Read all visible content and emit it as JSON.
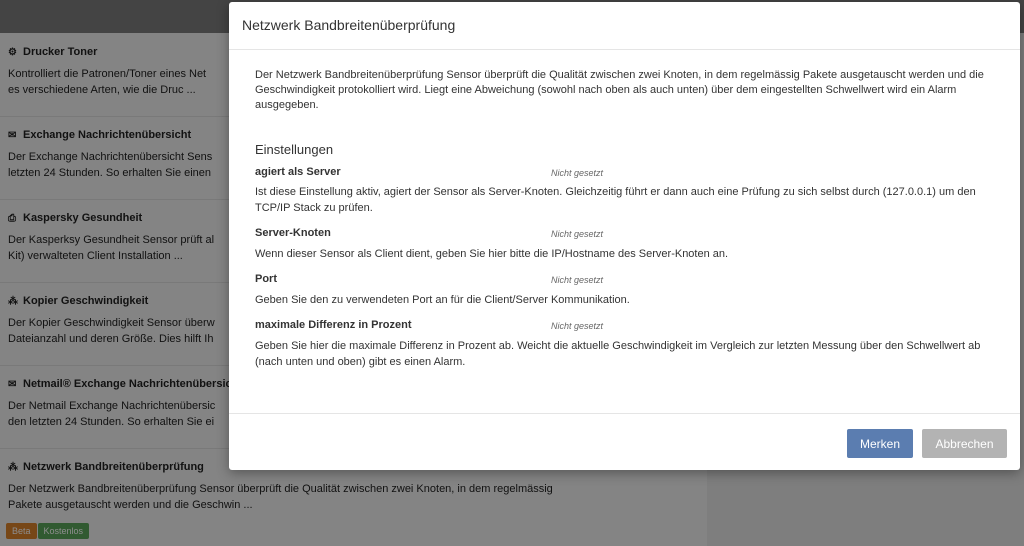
{
  "background": {
    "items": [
      {
        "icon": "gears-icon",
        "glyph": "⚙",
        "title": "Drucker Toner",
        "desc": "Kontrolliert die Patronen/Toner eines Net\nes verschiedene Arten, wie die Druc ..."
      },
      {
        "icon": "envelope-icon",
        "glyph": "✉",
        "title": "Exchange Nachrichtenübersicht",
        "desc": "Der Exchange Nachrichtenübersicht Sens\nletzten 24 Stunden. So erhalten Sie einen"
      },
      {
        "icon": "printer-icon",
        "glyph": "⎙",
        "title": "Kaspersky Gesundheit",
        "desc": "Der Kasperksy Gesundheit Sensor prüft al\nKit) verwalteten Client Installation ..."
      },
      {
        "icon": "sitemap-icon",
        "glyph": "⁂",
        "title": "Kopier Geschwindigkeit",
        "desc": "Der Kopier Geschwindigkeit Sensor überw\nDateianzahl und deren Größe. Dies hilft Ih"
      },
      {
        "icon": "envelope-icon",
        "glyph": "✉",
        "title": "Netmail® Exchange Nachrichtenübersicl",
        "desc": "Der Netmail Exchange Nachrichtenübersic\nden letzten 24 Stunden. So erhalten Sie ei"
      },
      {
        "icon": "sitemap-icon",
        "glyph": "⁂",
        "title": "Netzwerk Bandbreitenüberprüfung",
        "desc": "Der Netzwerk Bandbreitenüberprüfung Sensor überprüft die Qualität zwischen zwei Knoten, in dem regelmässig\nPakete ausgetauscht werden und die Geschwin ..."
      }
    ],
    "badges": [
      {
        "label": "Beta",
        "color": "#d9822b"
      },
      {
        "label": "Kostenlos",
        "color": "#5aa55a"
      }
    ]
  },
  "modal": {
    "title": "Netzwerk Bandbreitenüberprüfung",
    "intro": "Der Netzwerk Bandbreitenüberprüfung Sensor überprüft die Qualität zwischen zwei Knoten, in dem regelmässig Pakete ausgetauscht werden und die Geschwindigkeit protokolliert wird. Liegt eine Abweichung (sowohl nach oben als auch unten) über dem eingestellten Schwellwert wird ein Alarm ausgegeben.",
    "section_heading": "Einstellungen",
    "settings": [
      {
        "name": "agiert als Server",
        "status": "Nicht gesetzt",
        "desc": "Ist diese Einstellung aktiv, agiert der Sensor als Server-Knoten. Gleichzeitig führt er dann auch eine Prüfung zu sich selbst durch (127.0.0.1) um den TCP/IP Stack zu prüfen."
      },
      {
        "name": "Server-Knoten",
        "status": "Nicht gesetzt",
        "desc": "Wenn dieser Sensor als Client dient, geben Sie hier bitte die IP/Hostname des Server-Knoten an."
      },
      {
        "name": "Port",
        "status": "Nicht gesetzt",
        "desc": "Geben Sie den zu verwendeten Port an für die Client/Server Kommunikation."
      },
      {
        "name": "maximale Differenz in Prozent",
        "status": "Nicht gesetzt",
        "desc": "Geben Sie hier die maximale Differenz in Prozent ab. Weicht die aktuelle Geschwindigkeit im Vergleich zur letzten Messung über den Schwellwert ab (nach unten und oben) gibt es einen Alarm."
      }
    ],
    "buttons": {
      "save": "Merken",
      "cancel": "Abbrechen"
    }
  },
  "colors": {
    "primary": "#5b7db0",
    "secondary": "#b3b3b3"
  }
}
